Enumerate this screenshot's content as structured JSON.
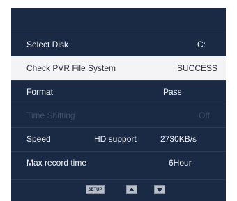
{
  "menu": {
    "select_disk": {
      "label": "Select Disk",
      "value": "C:"
    },
    "check_pvr": {
      "label": "Check PVR File System",
      "value": "SUCCESS"
    },
    "format": {
      "label": "Format",
      "value": "Pass"
    },
    "time_shifting": {
      "label": "Time Shifting",
      "value": "Off"
    },
    "speed": {
      "label": "Speed",
      "hd_label": "HD support",
      "value": "2730KB/s"
    },
    "max_record": {
      "label": "Max record time",
      "value": "6Hour"
    }
  },
  "footer": {
    "setup_label": "SETUP",
    "up_icon": "triangle-up-icon",
    "down_icon": "triangle-down-icon"
  },
  "colors": {
    "background": "#1a2a45",
    "selected_row": "#f4f4f6",
    "text": "#f2f4f8"
  }
}
